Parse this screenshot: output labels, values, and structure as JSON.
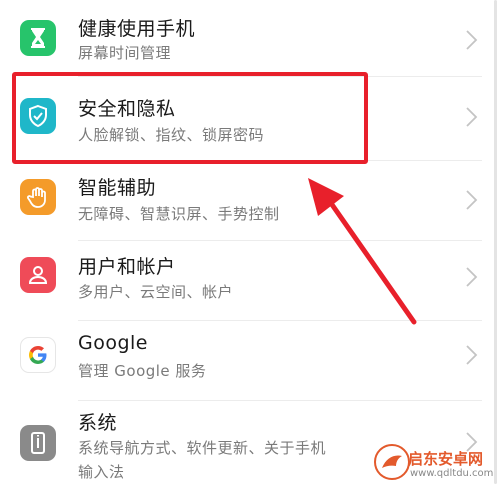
{
  "settings": {
    "items": [
      {
        "title": "健康使用手机",
        "subtitle": "屏幕时间管理",
        "icon": "hourglass-icon",
        "color": "#27c46b"
      },
      {
        "title": "安全和隐私",
        "subtitle": "人脸解锁、指纹、锁屏密码",
        "icon": "shield-icon",
        "color": "#1fb7c9"
      },
      {
        "title": "智能辅助",
        "subtitle": "无障碍、智慧识屏、手势控制",
        "icon": "hand-icon",
        "color": "#f49b2a"
      },
      {
        "title": "用户和帐户",
        "subtitle": "多用户、云空间、帐户",
        "icon": "user-icon",
        "color": "#ef4b58"
      },
      {
        "title": "Google",
        "subtitle": "管理 Google 服务",
        "icon": "google-icon",
        "color": "#ffffff"
      },
      {
        "title": "系统",
        "subtitle": "系统导航方式、软件更新、关于手机",
        "subtitle2": "输入法",
        "icon": "system-icon",
        "color": "#8a8a8a"
      }
    ]
  },
  "annotation": {
    "highlight_color": "#e8202b"
  },
  "watermark": {
    "name": "启东安卓网",
    "url": "www.qdltdu.com"
  }
}
